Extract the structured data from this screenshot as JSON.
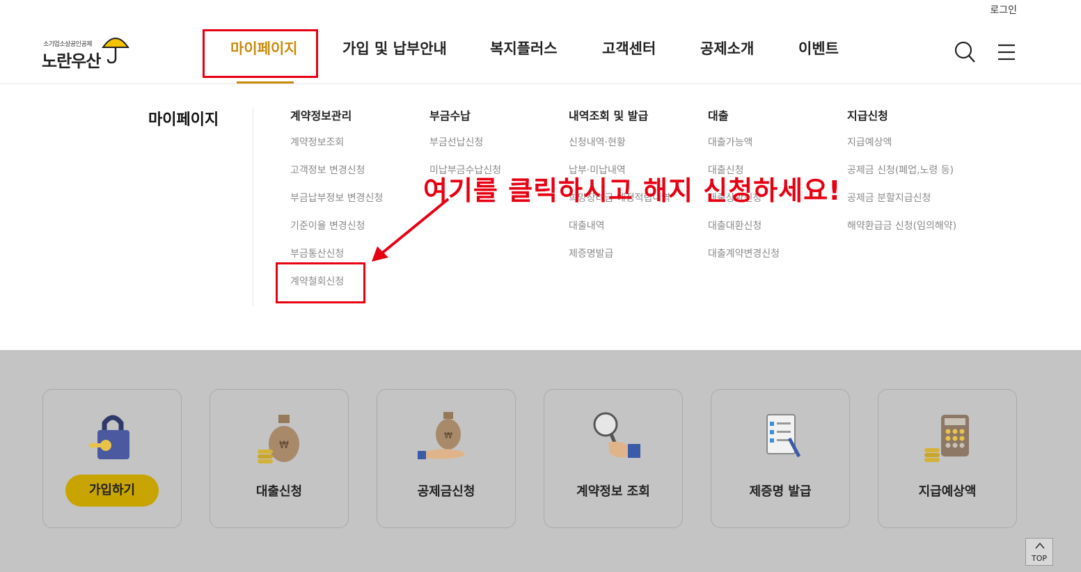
{
  "header": {
    "login": "로그인",
    "logo_sub": "소기업소상공인공제",
    "logo_main": "노란우산",
    "nav": [
      "마이페이지",
      "가입 및 납부안내",
      "복지플러스",
      "고객센터",
      "공제소개",
      "이벤트"
    ],
    "search_icon": "search-icon",
    "menu_icon": "hamburger-menu-icon"
  },
  "mega_menu": {
    "title": "마이페이지",
    "columns": [
      {
        "heading": "계약정보관리",
        "items": [
          "계약정보조회",
          "고객정보 변경신청",
          "부금납부정보 변경신청",
          "기준이율 변경신청",
          "부금통산신청",
          "계약철회신청"
        ]
      },
      {
        "heading": "부금수납",
        "items": [
          "부금선납신청",
          "미납부금수납신청"
        ]
      },
      {
        "heading": "내역조회 및 발급",
        "items": [
          "신청내역·현황",
          "납부·미납내역",
          "희망장려금 예정적립내역",
          "대출내역",
          "제증명발급"
        ]
      },
      {
        "heading": "대출",
        "items": [
          "대출가능액",
          "대출신청",
          "대출상환신청",
          "대출대환신청",
          "대출계약변경신청"
        ]
      },
      {
        "heading": "지급신청",
        "items": [
          "지급예상액",
          "공제금 신청(폐업,노령 등)",
          "공제금 분할지급신청",
          "해약환급금 신청(임의해약)"
        ]
      }
    ]
  },
  "annotation": {
    "text": "여기를 클릭하시고 해지 신청하세요!",
    "color": "#e60012"
  },
  "quick_menu": [
    {
      "label": "가입하기",
      "icon": "padlock-key-icon",
      "highlight": true
    },
    {
      "label": "대출신청",
      "icon": "money-bag-coins-icon"
    },
    {
      "label": "공제금신청",
      "icon": "money-bag-hand-icon"
    },
    {
      "label": "계약정보 조회",
      "icon": "magnifier-hand-icon"
    },
    {
      "label": "제증명 발급",
      "icon": "checklist-clipboard-icon"
    },
    {
      "label": "지급예상액",
      "icon": "calculator-coins-icon"
    }
  ],
  "top_button": "TOP",
  "colors": {
    "accent": "#c98b0b",
    "pill": "#c8a400",
    "annotation": "#e60012",
    "quick_bg": "#c4c4c4"
  }
}
